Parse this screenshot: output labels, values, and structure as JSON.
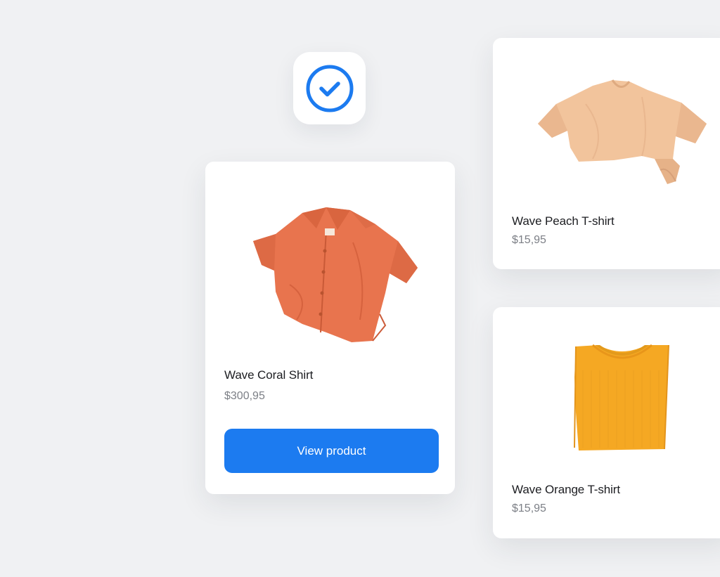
{
  "accent_color": "#1c7bf0",
  "status_icon": {
    "icon": "check-circle-icon"
  },
  "featured_product": {
    "name": "Wave Coral Shirt",
    "price": "$300,95",
    "image_icon": "coral-shirt-image",
    "button_label": "View product"
  },
  "products": [
    {
      "name": "Wave Peach T-shirt",
      "price": "$15,95",
      "image_icon": "peach-tshirt-image"
    },
    {
      "name": "Wave Orange T-shirt",
      "price": "$15,95",
      "image_icon": "orange-tshirt-image"
    }
  ]
}
